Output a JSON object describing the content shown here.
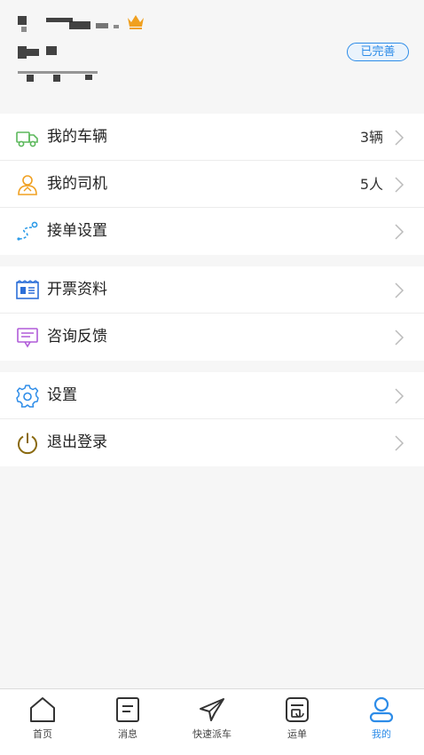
{
  "profile": {
    "badge": "已完善"
  },
  "menu_groups": [
    [
      {
        "label": "我的车辆",
        "value": "3辆",
        "icon": "truck-icon",
        "color": "#5cb85c"
      },
      {
        "label": "我的司机",
        "value": "5人",
        "icon": "driver-icon",
        "color": "#f0a020"
      },
      {
        "label": "接单设置",
        "value": "",
        "icon": "route-icon",
        "color": "#2d9be8"
      }
    ],
    [
      {
        "label": "开票资料",
        "value": "",
        "icon": "invoice-icon",
        "color": "#2d6fd8"
      },
      {
        "label": "咨询反馈",
        "value": "",
        "icon": "feedback-icon",
        "color": "#b05cd8"
      }
    ],
    [
      {
        "label": "设置",
        "value": "",
        "icon": "gear-icon",
        "color": "#2d8ce8"
      },
      {
        "label": "退出登录",
        "value": "",
        "icon": "power-icon",
        "color": "#8a6a10"
      }
    ]
  ],
  "tabbar": {
    "items": [
      "首页",
      "消息",
      "快速派车",
      "运单",
      "我的"
    ],
    "active_color": "#2d8ce8"
  }
}
